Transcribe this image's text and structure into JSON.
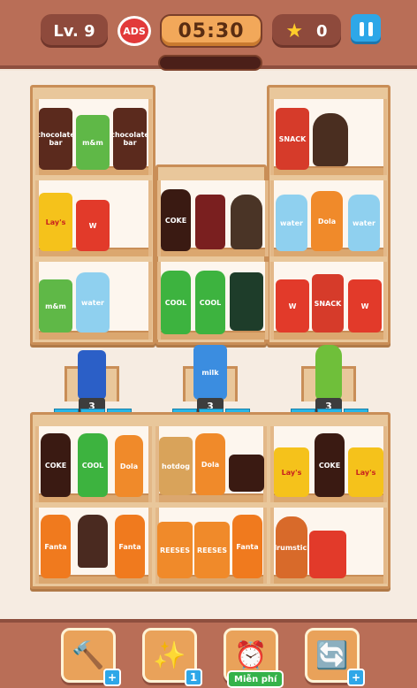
{
  "header": {
    "level_label": "Lv. 9",
    "ads_label": "ADS",
    "timer": "05:30",
    "stars_count": "0",
    "stars_icon": "star-icon",
    "pause_icon": "pause-icon",
    "progress_fraction": 0
  },
  "items": {
    "chocolate": "chocolate bar",
    "mm": "m&m",
    "lays": "Lay's",
    "fries": "W",
    "coke": "COKE",
    "cool": "COOL",
    "dola": "Dola",
    "snack": "SNACK",
    "water": "water",
    "milk": "milk",
    "reese": "REESES",
    "hotdog": "hotdog",
    "drumstick": "drumstick",
    "fanta": "Fanta"
  },
  "pedestals": [
    {
      "count": "3"
    },
    {
      "count": "3"
    },
    {
      "count": "3"
    }
  ],
  "boosters": [
    {
      "icon": "hammer-icon",
      "badge": "+"
    },
    {
      "icon": "magic-wand-icon",
      "badge": "1"
    },
    {
      "icon": "alarm-clock-icon",
      "badge": "Miễn phí"
    },
    {
      "icon": "shuffle-icon",
      "badge": "+"
    }
  ],
  "colors": {
    "header": "#b96e57",
    "timer": "#f2a85a",
    "accent_blue": "#2ea7e8",
    "free_green": "#35b24a"
  }
}
